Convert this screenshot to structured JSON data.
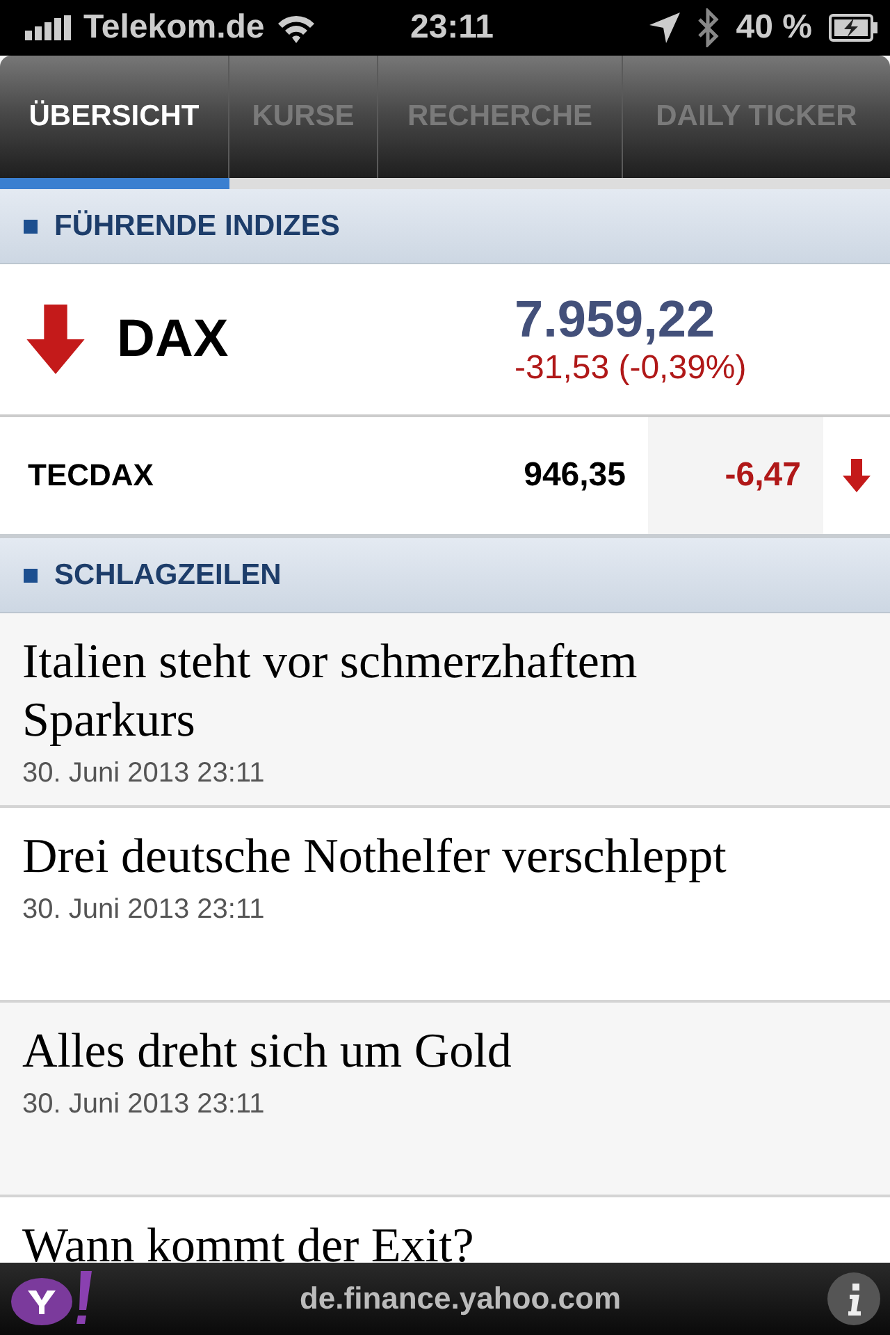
{
  "status_bar": {
    "carrier": "Telekom.de",
    "time": "23:11",
    "battery": "40 %"
  },
  "tabs": [
    {
      "label": "ÜBERSICHT",
      "selected": true
    },
    {
      "label": "KURSE",
      "selected": false
    },
    {
      "label": "RECHERCHE",
      "selected": false
    },
    {
      "label": "DAILY TICKER",
      "selected": false
    }
  ],
  "indices_section": {
    "title": "FÜHRENDE INDIZES"
  },
  "main_index": {
    "name": "DAX",
    "value": "7.959,22",
    "change": "-31,53 (-0,39%)",
    "falling": true
  },
  "indices": [
    {
      "name": "TECDAX",
      "value": "946,35",
      "change": "-6,47",
      "falling": true
    }
  ],
  "headlines_section": {
    "title": "SCHLAGZEILEN"
  },
  "headlines": [
    {
      "title": "Italien steht vor schmerzhaftem Sparkurs",
      "date": "30. Juni 2013 23:11"
    },
    {
      "title": "Drei deutsche Nothelfer verschleppt",
      "date": "30. Juni 2013 23:11"
    },
    {
      "title": "Alles dreht sich um Gold",
      "date": "30. Juni 2013 23:11"
    },
    {
      "title": "Wann kommt der Exit?"
    }
  ],
  "bottom_bar": {
    "url": "de.finance.yahoo.com"
  }
}
